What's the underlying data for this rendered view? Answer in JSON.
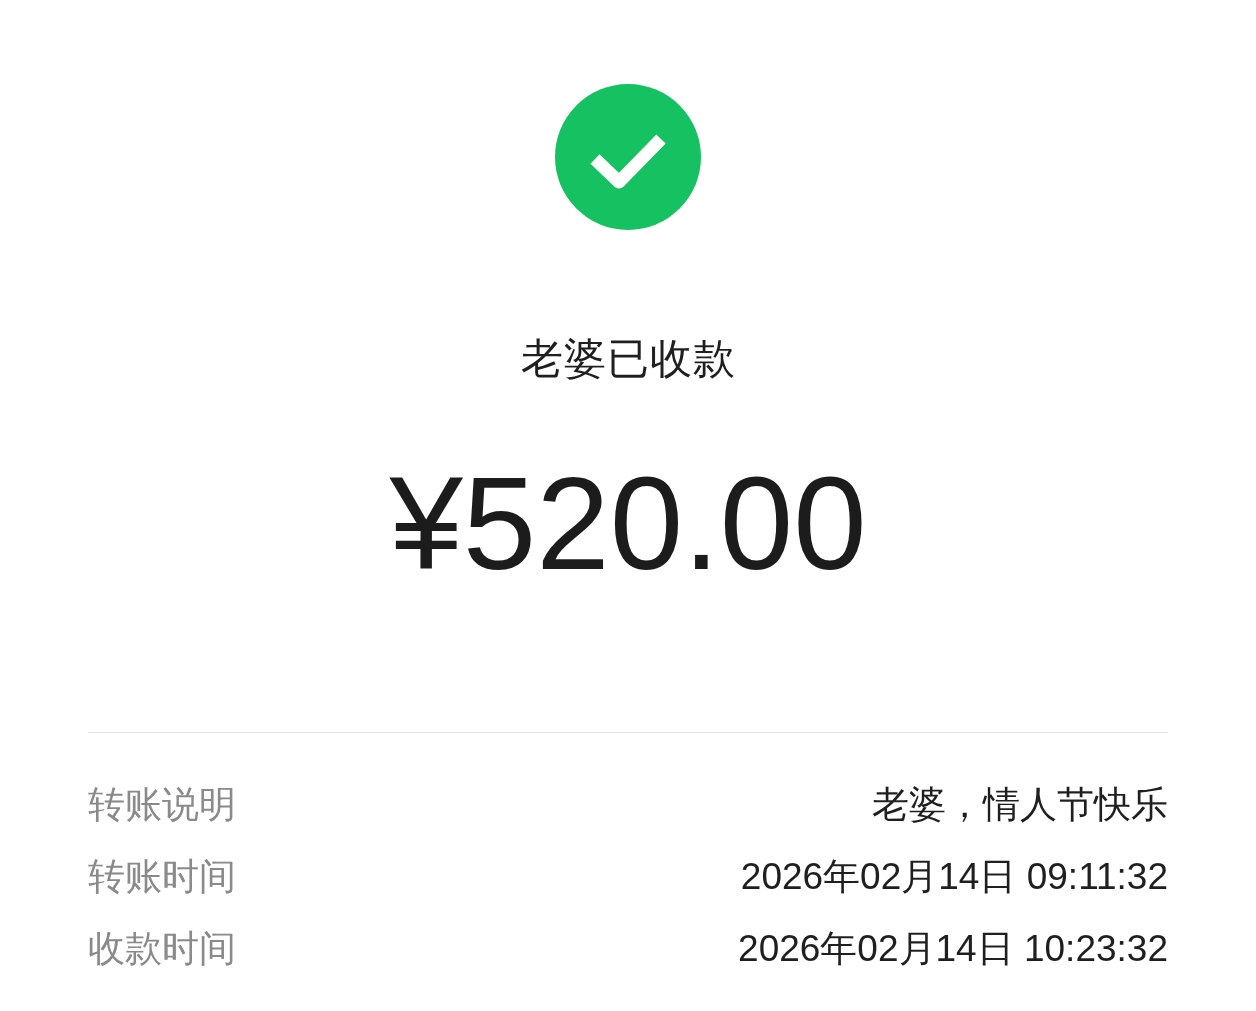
{
  "status": {
    "title": "老婆已收款",
    "amount": "¥520.00"
  },
  "details": [
    {
      "label": "转账说明",
      "value": "老婆，情人节快乐"
    },
    {
      "label": "转账时间",
      "value": "2026年02月14日 09:11:32"
    },
    {
      "label": "收款时间",
      "value": "2026年02月14日 10:23:32"
    }
  ]
}
